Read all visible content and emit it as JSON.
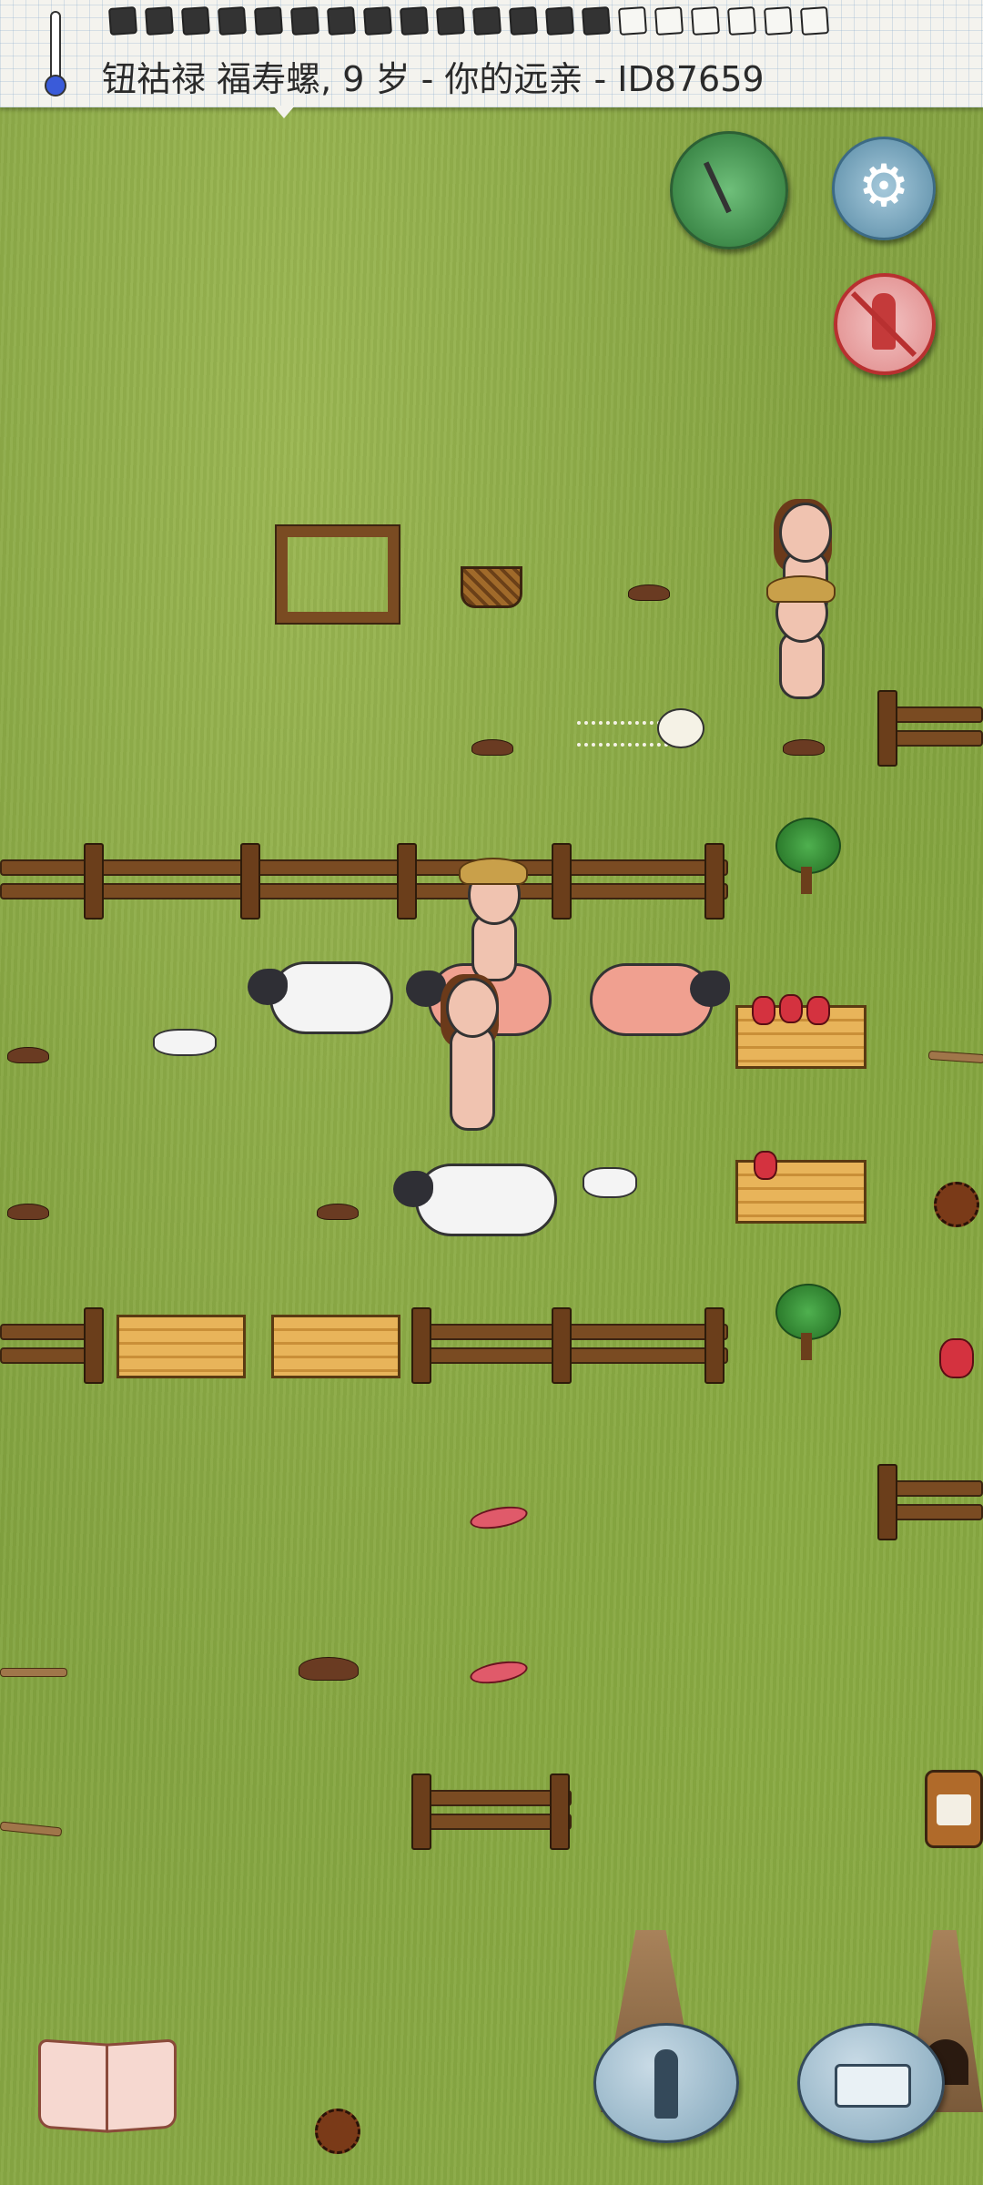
{
  "hud": {
    "title": "钮祜禄 福寿螺, 9 岁 - 你的远亲 - ID87659",
    "food_pips_filled": 14,
    "food_pips_total": 20,
    "temperature_icon": "thermometer-icon"
  },
  "controls": {
    "compass_icon": "compass-icon",
    "settings_icon": "gear-icon",
    "settings_glyph": "⚙",
    "no_kill_icon": "no-attack-icon",
    "tech_book_icon": "book-icon",
    "puppet_icon": "marionette-icon",
    "keyboard_icon": "keyboard-icon"
  },
  "colors": {
    "grass": "#7ea23e",
    "compass": "#3e8a4a",
    "settings": "#6f9db5",
    "no_kill": "#b83030",
    "bubble": "#8fb0c3"
  }
}
